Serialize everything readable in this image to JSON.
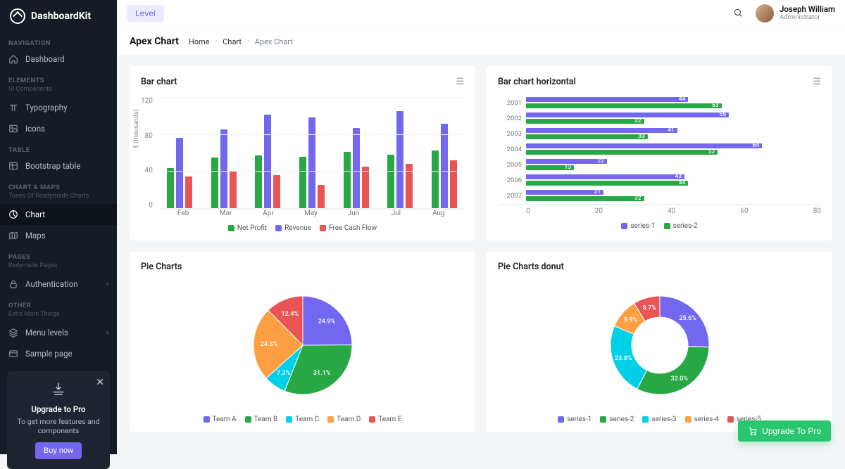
{
  "brand": "DashboardKit",
  "topbar": {
    "level_label": "Level",
    "user_name": "Joseph William",
    "user_role": "Administrator"
  },
  "page": {
    "title": "Apex Chart",
    "crumbs": [
      "Home",
      "Chart",
      "Apex Chart"
    ]
  },
  "sidebar": {
    "sections": [
      {
        "title": "NAVIGATION",
        "sub": "",
        "items": [
          {
            "icon": "home",
            "label": "Dashboard"
          }
        ]
      },
      {
        "title": "ELEMENTS",
        "sub": "UI Components",
        "items": [
          {
            "icon": "type",
            "label": "Typography"
          },
          {
            "icon": "image",
            "label": "Icons"
          }
        ]
      },
      {
        "title": "TABLE",
        "sub": "",
        "items": [
          {
            "icon": "table",
            "label": "Bootstrap table"
          }
        ]
      },
      {
        "title": "CHART & MAPS",
        "sub": "Tones Of Readymade Charts",
        "items": [
          {
            "icon": "pie",
            "label": "Chart",
            "active": true
          },
          {
            "icon": "map",
            "label": "Maps"
          }
        ]
      },
      {
        "title": "PAGES",
        "sub": "Redymade Pages",
        "items": [
          {
            "icon": "lock",
            "label": "Authentication",
            "chev": true
          }
        ]
      },
      {
        "title": "OTHER",
        "sub": "Extra More Things",
        "items": [
          {
            "icon": "layers",
            "label": "Menu levels",
            "chev": true
          },
          {
            "icon": "card",
            "label": "Sample page"
          }
        ]
      }
    ]
  },
  "promo": {
    "title": "Upgrade to Pro",
    "text": "To get more features and components",
    "button": "Buy now"
  },
  "fab_label": "Upgrade To Pro",
  "cards": {
    "barv": "Bar chart",
    "barh": "Bar chart horizontal",
    "pie": "Pie Charts",
    "donut": "Pie Charts donut"
  },
  "colors": {
    "green": "#28a745",
    "purple": "#7367f0",
    "red": "#ea5455",
    "cyan": "#00cfe8",
    "amber": "#ff9f43"
  },
  "chart_data": [
    {
      "id": "barv",
      "type": "bar",
      "ylabel": "$ (thousands)",
      "ylim": [
        0,
        120
      ],
      "yticks": [
        0,
        40,
        80,
        120
      ],
      "categories": [
        "Feb",
        "Mar",
        "Apr",
        "May",
        "Jun",
        "Jul",
        "Aug"
      ],
      "series": [
        {
          "name": "Net Profit",
          "color": "green",
          "values": [
            44,
            55,
            57,
            56,
            61,
            58,
            63
          ]
        },
        {
          "name": "Revenue",
          "color": "purple",
          "values": [
            76,
            85,
            101,
            98,
            87,
            105,
            91
          ]
        },
        {
          "name": "Free Cash Flow",
          "color": "red",
          "values": [
            35,
            41,
            36,
            26,
            45,
            48,
            52
          ]
        }
      ]
    },
    {
      "id": "barh",
      "type": "bar-horizontal",
      "xlim": [
        0,
        80
      ],
      "xticks": [
        0,
        20,
        40,
        60,
        80
      ],
      "categories": [
        "2001",
        "2002",
        "2003",
        "2004",
        "2005",
        "2006",
        "2007"
      ],
      "series": [
        {
          "name": "series-1",
          "color": "purple",
          "values": [
            44,
            55,
            41,
            64,
            22,
            43,
            21
          ]
        },
        {
          "name": "series-2",
          "color": "green",
          "values": [
            53,
            32,
            33,
            52,
            13,
            44,
            32
          ]
        }
      ]
    },
    {
      "id": "pie",
      "type": "pie",
      "series": [
        {
          "name": "Team A",
          "color": "purple",
          "value": 24.9
        },
        {
          "name": "Team B",
          "color": "green",
          "value": 31.1
        },
        {
          "name": "Team C",
          "color": "cyan",
          "value": 7.3
        },
        {
          "name": "Team D",
          "color": "amber",
          "value": 24.3
        },
        {
          "name": "Team E",
          "color": "red",
          "value": 12.4
        }
      ]
    },
    {
      "id": "donut",
      "type": "donut",
      "series": [
        {
          "name": "series-1",
          "color": "purple",
          "value": 25.6
        },
        {
          "name": "series-2",
          "color": "green",
          "value": 32.0
        },
        {
          "name": "series-3",
          "color": "cyan",
          "value": 23.8
        },
        {
          "name": "series-4",
          "color": "amber",
          "value": 9.9
        },
        {
          "name": "series-5",
          "color": "red",
          "value": 8.7
        }
      ]
    }
  ]
}
